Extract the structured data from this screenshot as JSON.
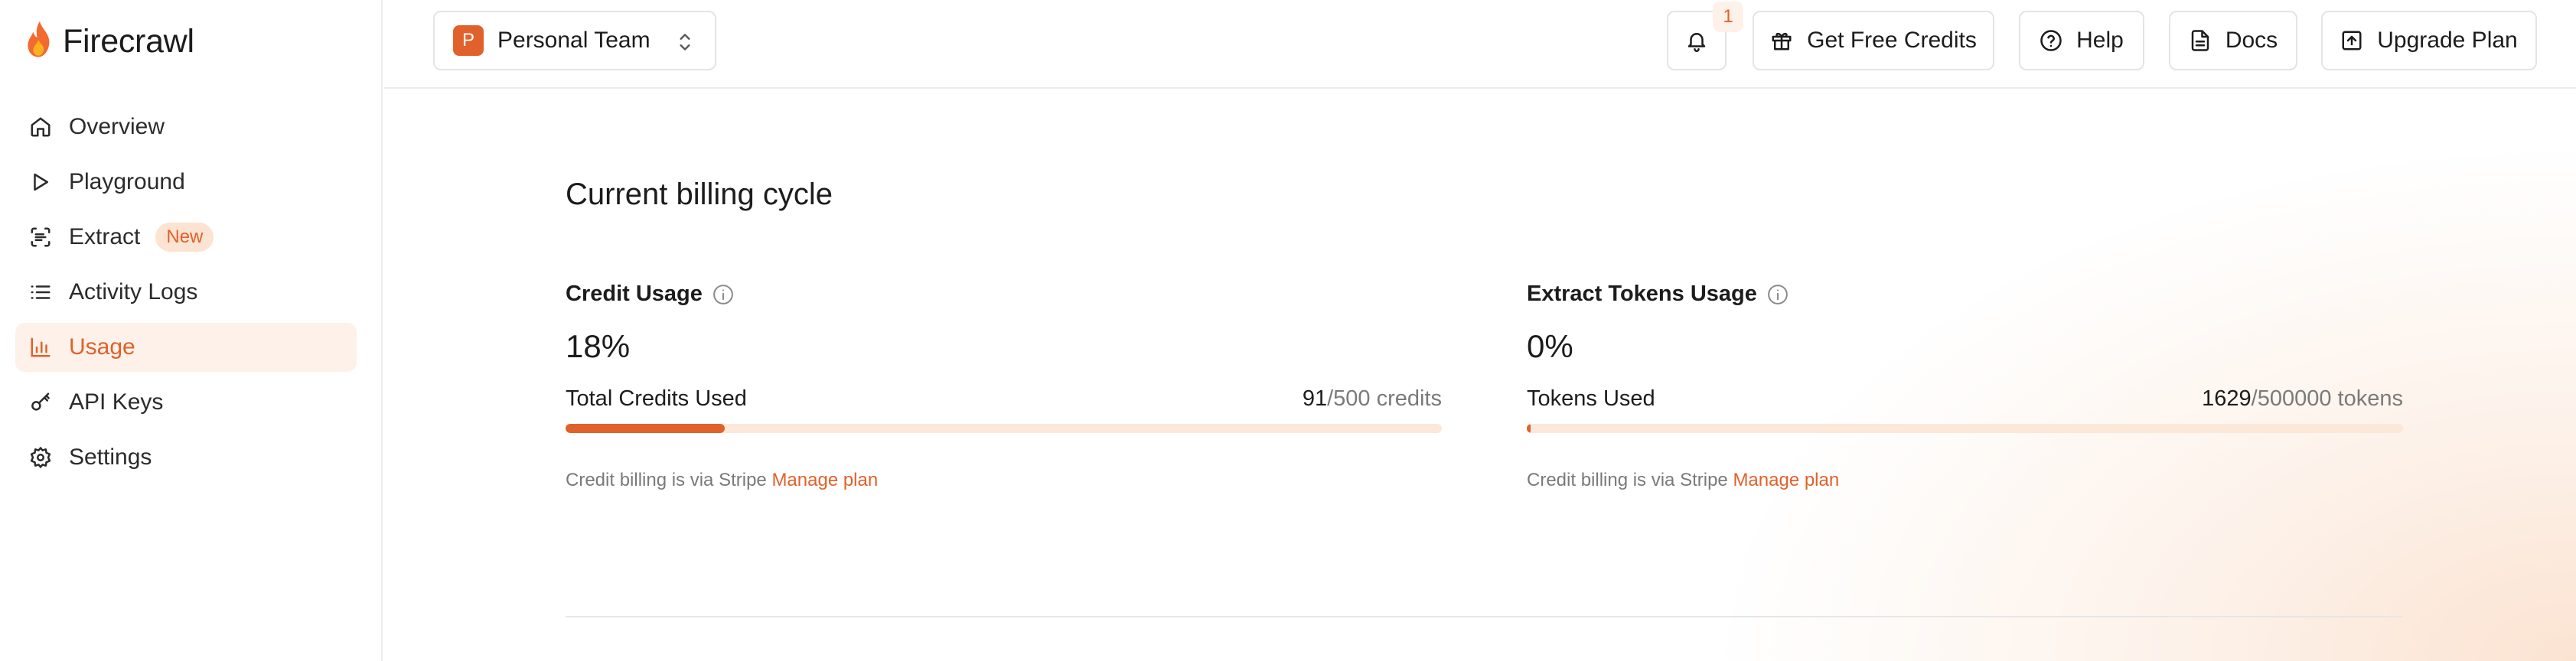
{
  "app": {
    "name": "Firecrawl"
  },
  "sidebar": {
    "items": [
      {
        "label": "Overview",
        "icon": "home-icon",
        "active": false
      },
      {
        "label": "Playground",
        "icon": "play-icon",
        "active": false
      },
      {
        "label": "Extract",
        "icon": "scan-text-icon",
        "active": false,
        "badge": "New"
      },
      {
        "label": "Activity Logs",
        "icon": "list-icon",
        "active": false
      },
      {
        "label": "Usage",
        "icon": "bar-chart-icon",
        "active": true
      },
      {
        "label": "API Keys",
        "icon": "key-icon",
        "active": false
      },
      {
        "label": "Settings",
        "icon": "gear-icon",
        "active": false
      }
    ]
  },
  "topbar": {
    "team": {
      "initial": "P",
      "name": "Personal Team"
    },
    "notifications": {
      "count": "1"
    },
    "buttons": {
      "credits": "Get Free Credits",
      "help": "Help",
      "docs": "Docs",
      "upgrade": "Upgrade Plan"
    }
  },
  "main": {
    "title": "Current billing cycle",
    "credit": {
      "title": "Credit Usage",
      "percent": "18%",
      "label": "Total Credits Used",
      "used": "91",
      "limit": "/500 credits",
      "fill": 0.182,
      "note": "Credit billing is via Stripe ",
      "link": "Manage plan"
    },
    "tokens": {
      "title": "Extract Tokens Usage",
      "percent": "0%",
      "label": "Tokens Used",
      "used": "1629",
      "limit": "/500000 tokens",
      "fill": 0.00326,
      "note": "Credit billing is via Stripe ",
      "link": "Manage plan"
    }
  },
  "colors": {
    "accent": "#e0612b",
    "accent_light": "#fdf1e9",
    "track": "#fbe8d9"
  }
}
